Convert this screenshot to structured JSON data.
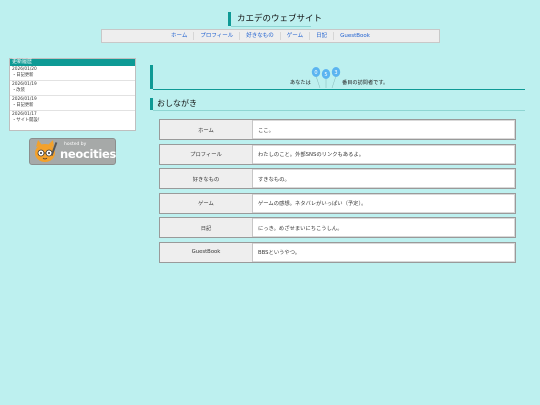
{
  "site": {
    "title": "カエデのウェブサイト"
  },
  "nav": [
    "ホーム",
    "プロフィール",
    "好きなもの",
    "ゲーム",
    "日記",
    "GuestBook"
  ],
  "updates": {
    "heading": "更新履歴",
    "entries": [
      {
        "date": "2026/01/20",
        "text": "・日記更新"
      },
      {
        "date": "2026/01/19",
        "text": "・改装"
      },
      {
        "date": "2026/01/19",
        "text": "・日記更新"
      },
      {
        "date": "2026/01/17",
        "text": "・サイト開設！"
      }
    ]
  },
  "badge": {
    "hosted": "hosted by",
    "brand": "neocities"
  },
  "counter": {
    "prefix": "あなたは",
    "digits": [
      "0",
      "5",
      "3"
    ],
    "suffix": "番目の訪問者です。"
  },
  "section": {
    "title": "おしながき"
  },
  "menu": [
    {
      "label": "ホーム",
      "desc": "ここ。"
    },
    {
      "label": "プロフィール",
      "desc": "わたしのこと。外部SNSのリンクもあるよ。"
    },
    {
      "label": "好きなもの",
      "desc": "すきなもの。"
    },
    {
      "label": "ゲーム",
      "desc": "ゲームの感想。ネタバレがいっぱい（予定）。"
    },
    {
      "label": "日記",
      "desc": "にっき。めざせまいにちこうしん。"
    },
    {
      "label": "GuestBook",
      "desc": "BBSというやつ。"
    }
  ],
  "colors": {
    "background": "#bdf0ef",
    "accent": "#0e9a95",
    "link": "#1c5fd0",
    "balloon": "#5bb4f0"
  }
}
